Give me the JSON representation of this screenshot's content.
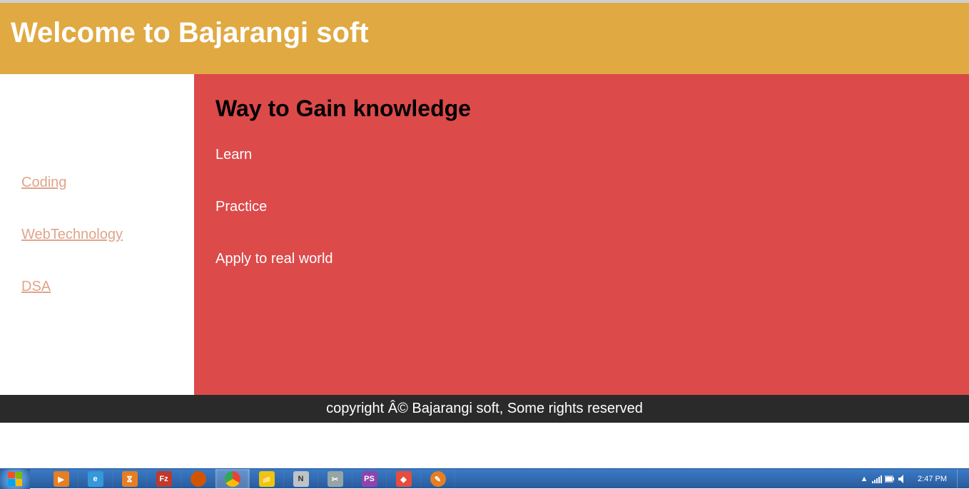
{
  "header": {
    "title": "Welcome to Bajarangi soft"
  },
  "sidebar": {
    "links": [
      {
        "label": "Coding"
      },
      {
        "label": "WebTechnology"
      },
      {
        "label": "DSA"
      }
    ]
  },
  "main": {
    "heading": "Way to Gain knowledge",
    "items": [
      {
        "label": "Learn"
      },
      {
        "label": "Practice"
      },
      {
        "label": "Apply to real world"
      }
    ]
  },
  "footer": {
    "text": "copyright Â© Bajarangi soft, Some rights reserved"
  },
  "taskbar": {
    "clock": "2:47 PM",
    "icons": [
      {
        "name": "media-player-icon",
        "bg": "#e67e22"
      },
      {
        "name": "ie-icon",
        "bg": "#3498db"
      },
      {
        "name": "xampp-icon",
        "bg": "#e67e22"
      },
      {
        "name": "filezilla-icon",
        "bg": "#c0392b"
      },
      {
        "name": "firefox-icon",
        "bg": "#d35400"
      },
      {
        "name": "chrome-icon",
        "bg": "#ecf0f1"
      },
      {
        "name": "explorer-icon",
        "bg": "#f1c40f"
      },
      {
        "name": "notepad-icon",
        "bg": "#bdc3c7"
      },
      {
        "name": "snipping-icon",
        "bg": "#95a5a6"
      },
      {
        "name": "phpstorm-icon",
        "bg": "#8e44ad"
      },
      {
        "name": "anydesk-icon",
        "bg": "#e74c3c"
      },
      {
        "name": "sublime-icon",
        "bg": "#e67e22"
      }
    ]
  }
}
